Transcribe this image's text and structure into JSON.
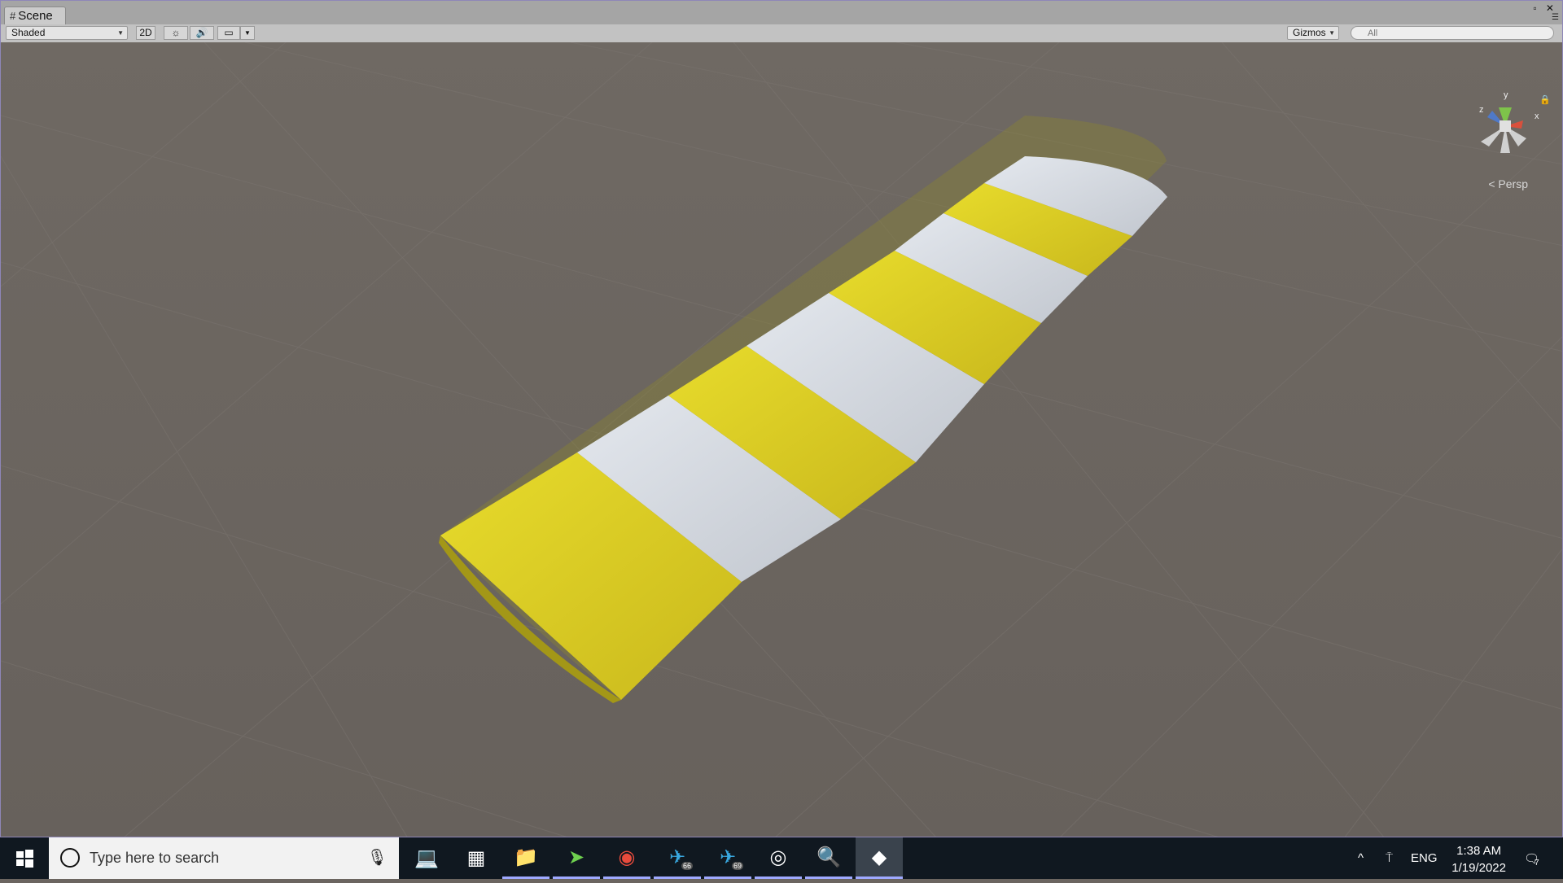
{
  "window": {
    "tab_title": "Scene",
    "controls": "▫ ✕"
  },
  "toolbar": {
    "shading_mode": "Shaded",
    "btn_2d": "2D",
    "gizmos_label": "Gizmos",
    "search_placeholder": "All"
  },
  "scene": {
    "projection_label": "Persp",
    "axis_labels": {
      "x": "x",
      "y": "y",
      "z": "z"
    }
  },
  "taskbar": {
    "search_placeholder": "Type here to search",
    "apps": [
      {
        "name": "terminal-app",
        "icon": "💻"
      },
      {
        "name": "calculator-app",
        "icon": "▦"
      },
      {
        "name": "file-explorer-app",
        "icon": "📁"
      },
      {
        "name": "send-app",
        "icon": "➤"
      },
      {
        "name": "chrome-app",
        "icon": "◉"
      },
      {
        "name": "telegram-app-1",
        "icon": "✈",
        "badge": "66"
      },
      {
        "name": "telegram-app-2",
        "icon": "✈",
        "badge": "69"
      },
      {
        "name": "obs-app",
        "icon": "◎"
      },
      {
        "name": "search-tool-app",
        "icon": "🔍"
      },
      {
        "name": "unity-app",
        "icon": "◆"
      }
    ],
    "tray_lang": "ENG",
    "time": "1:38 AM",
    "date": "1/19/2022",
    "notifications_count": "7"
  }
}
